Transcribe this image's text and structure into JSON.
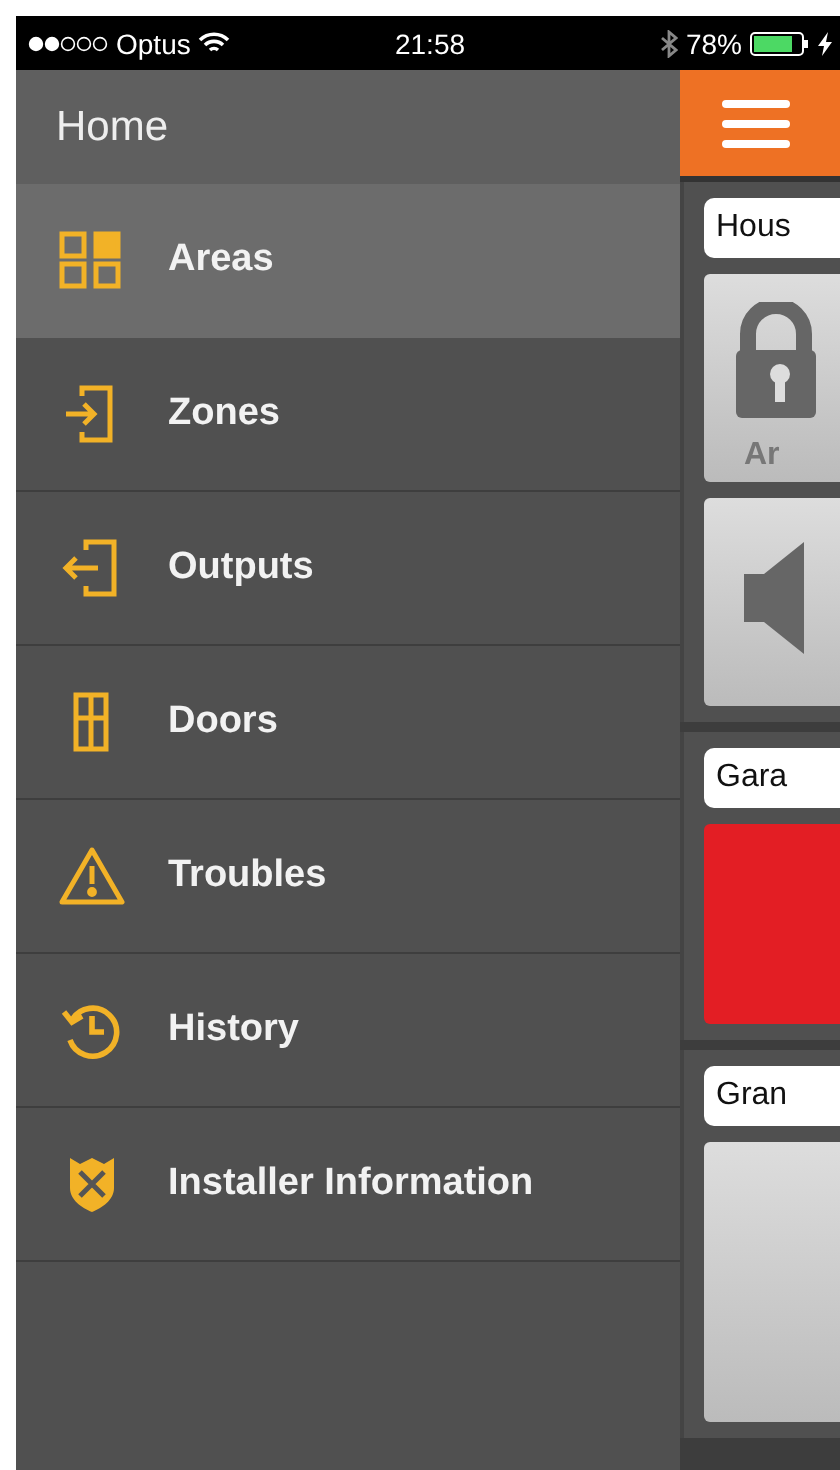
{
  "status_bar": {
    "carrier": "Optus",
    "time": "21:58",
    "battery": "78%"
  },
  "header": {
    "title": "Home"
  },
  "menu": [
    {
      "label": "Areas",
      "kind": "areas",
      "selected": true
    },
    {
      "label": "Zones",
      "kind": "zones",
      "selected": false
    },
    {
      "label": "Outputs",
      "kind": "outputs",
      "selected": false
    },
    {
      "label": "Doors",
      "kind": "doors",
      "selected": false
    },
    {
      "label": "Troubles",
      "kind": "troubles",
      "selected": false
    },
    {
      "label": "History",
      "kind": "history",
      "selected": false
    },
    {
      "label": "Installer Information",
      "kind": "installer",
      "selected": false
    }
  ],
  "areas": [
    {
      "name": "Hous",
      "tiles": [
        {
          "kind": "lock",
          "label": "Ar"
        },
        {
          "kind": "speaker"
        }
      ]
    },
    {
      "name": "Gara",
      "tiles": [
        {
          "kind": "alarm"
        }
      ]
    },
    {
      "name": "Gran",
      "tiles": [
        {
          "kind": "blank"
        }
      ]
    }
  ]
}
